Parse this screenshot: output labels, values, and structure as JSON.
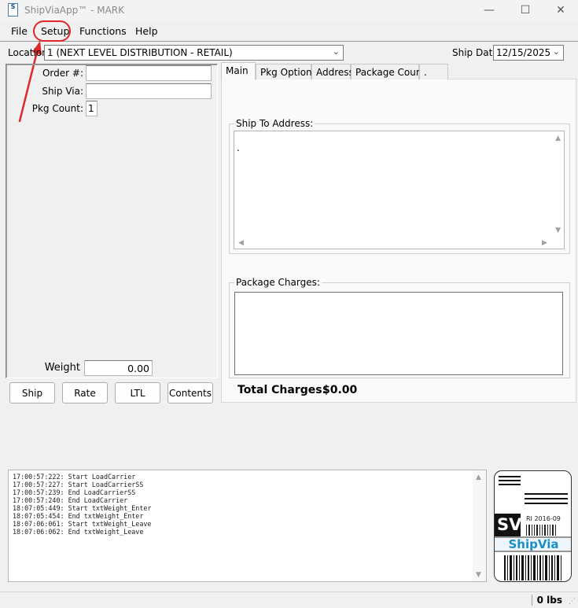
{
  "window": {
    "title": "ShipViaApp™ - MARK",
    "icon_letter": "S",
    "minimize": "—",
    "maximize": "☐",
    "close": "✕"
  },
  "menu": {
    "file": "File",
    "setup": "Setup",
    "functions": "Functions",
    "help": "Help"
  },
  "toolbar": {
    "location_label": "Location",
    "location_value": "1 (NEXT LEVEL DISTRIBUTION - RETAIL)",
    "ship_date_label": "Ship Date:",
    "ship_date_value": "12/15/2025"
  },
  "order": {
    "order_label": "Order #:",
    "order_value": "",
    "ship_via_label": "Ship Via:",
    "ship_via_value": "",
    "pkg_count_label": "Pkg Count:",
    "pkg_count_value": "1",
    "weight_label": "Weight",
    "weight_value": "0.00"
  },
  "buttons": {
    "ship": "Ship",
    "rate": "Rate",
    "ltl": "LTL",
    "contents": "Contents"
  },
  "tabs": [
    "Main",
    "Pkg Options",
    "Address",
    "Package Count",
    "."
  ],
  "main_tab": {
    "ship_to_title": "Ship To Address:",
    "ship_to_text": ".",
    "package_charges_title": "Package Charges:",
    "total_label": "Total Charges:",
    "total_value": "$0.00"
  },
  "log_lines": [
    "17:00:57:222: Start LoadCarrier",
    "17:00:57:227: Start LoadCarrierSS",
    "17:00:57:239: End LoadCarrierSS",
    "17:00:57:240: End LoadCarrier",
    "18:07:05:449: Start txtWeight_Enter",
    "18:07:05:454: End txtWeight_Enter",
    "18:07:06:061: Start txtWeight_Leave",
    "18:07:06:062: End txtWeight_Leave"
  ],
  "logo": {
    "sv": "SV",
    "version": "RI 2016-09",
    "brand": "ShipVia"
  },
  "status": {
    "weight": "0 lbs"
  },
  "colors": {
    "highlight": "#e0262a",
    "brand": "#1a8fc7"
  }
}
